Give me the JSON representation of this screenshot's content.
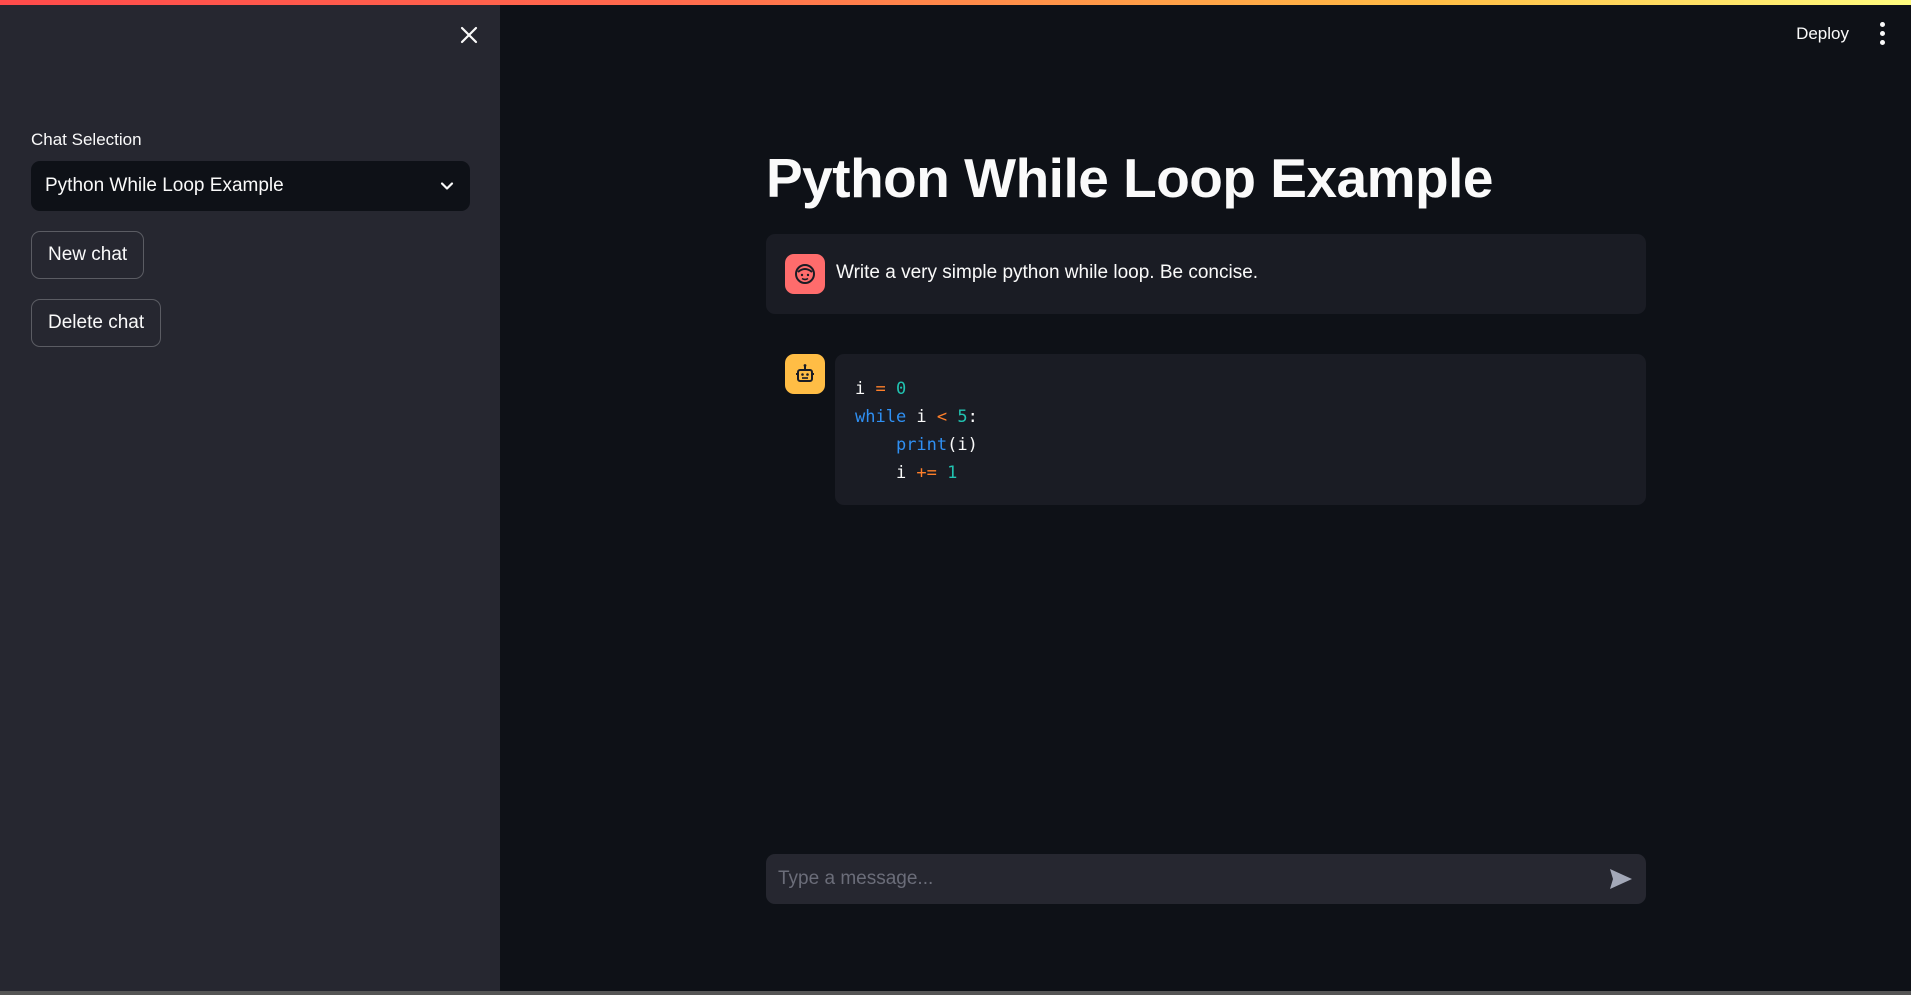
{
  "sidebar": {
    "label": "Chat Selection",
    "selected_chat": "Python While Loop Example",
    "new_chat_label": "New chat",
    "delete_chat_label": "Delete chat"
  },
  "header": {
    "deploy_label": "Deploy"
  },
  "main": {
    "title": "Python While Loop Example",
    "user_message": "Write a very simple python while loop. Be concise.",
    "code_lines": [
      "i = 0",
      "while i < 5:",
      "    print(i)",
      "    i += 1"
    ]
  },
  "input": {
    "placeholder": "Type a message..."
  },
  "colors": {
    "background": "#0e1117",
    "sidebar": "#262730",
    "user_avatar": "#ff6c6c",
    "bot_avatar": "#ffbd45",
    "accent_red": "#ff4b4b"
  },
  "icons": [
    "close-icon",
    "chevron-down-icon",
    "more-vert-icon",
    "user-face-icon",
    "robot-icon",
    "send-icon"
  ]
}
